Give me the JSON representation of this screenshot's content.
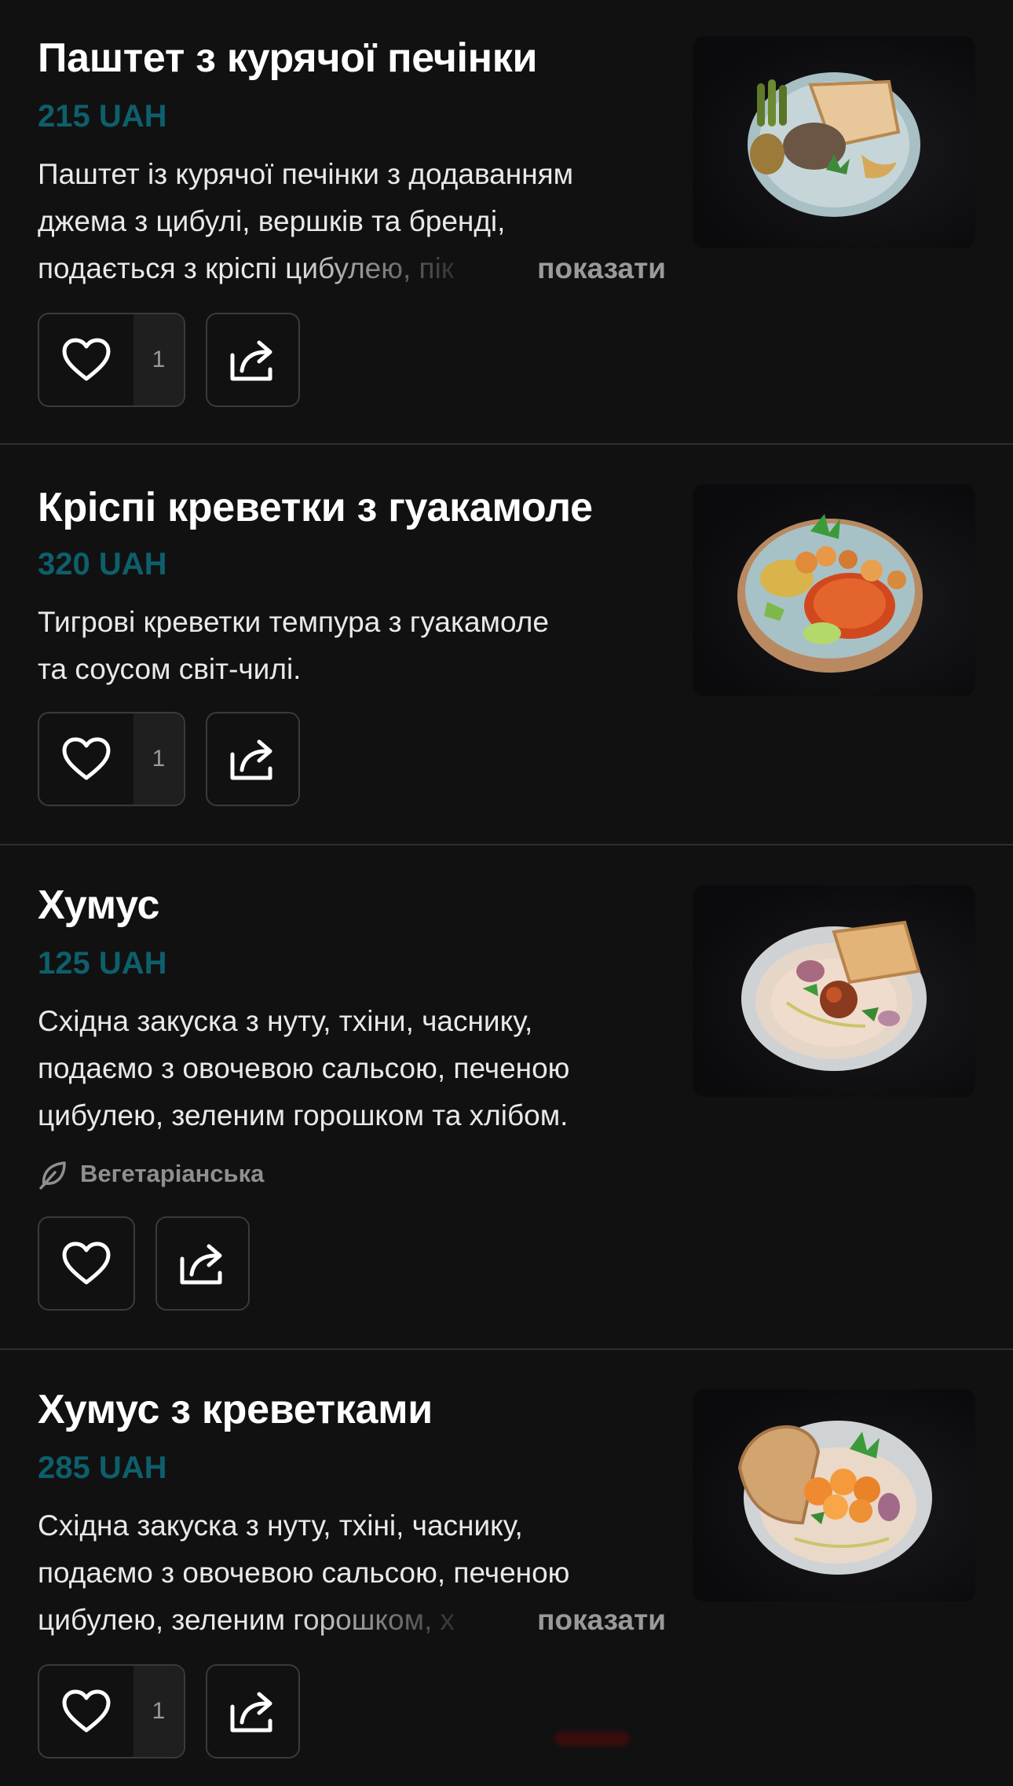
{
  "items": [
    {
      "title": "Паштет з курячої печінки",
      "price": "215 UAH",
      "description_lines": [
        "Паштет із курячої печінки з додаванням",
        "джема з цибулі, вершків та бренді,"
      ],
      "description_truncated": "подається з кріспі цибулею, пік",
      "show_more": "показати",
      "likes": "1",
      "image_icon": "food-photo-pate-plate"
    },
    {
      "title": "Кріспі креветки з гуакамоле",
      "price": "320 UAH",
      "description_lines": [
        "Тигрові креветки темпура з гуакамоле",
        "та соусом світ-чилі."
      ],
      "likes": "1",
      "image_icon": "food-photo-shrimp-bowl"
    },
    {
      "title": "Хумус",
      "price": "125 UAH",
      "description_lines": [
        "Східна закуска з нуту, тхіни, часнику,",
        "подаємо з овочевою сальсою, печеною",
        "цибулею, зеленим горошком та хлібом."
      ],
      "tag": "Вегетаріанська",
      "image_icon": "food-photo-hummus-bowl"
    },
    {
      "title": "Хумус з креветками",
      "price": "285 UAH",
      "description_lines": [
        "Східна закуска з нуту, тхіні, часнику,",
        "подаємо з овочевою сальсою, печеною"
      ],
      "description_truncated": "цибулею, зеленим горошком, х",
      "show_more": "показати",
      "likes": "1",
      "image_icon": "food-photo-hummus-shrimp-bowl"
    }
  ],
  "colors": {
    "background": "#111111",
    "price": "#0d5f6b",
    "divider": "#2e2e2e",
    "button_border": "#3a3a3a",
    "muted_text": "#9a9a9a"
  },
  "icons": [
    "heart-icon",
    "share-icon",
    "leaf-icon"
  ]
}
